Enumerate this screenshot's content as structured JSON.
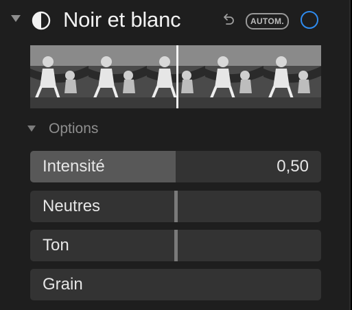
{
  "header": {
    "title": "Noir et blanc",
    "auto_label": "AUTOM.",
    "accent_color": "#2f8cf0",
    "icons": [
      "chevron-down-icon",
      "black-and-white-icon",
      "undo-icon",
      "circle-toggle-icon"
    ]
  },
  "options": {
    "label": "Options"
  },
  "sliders": [
    {
      "label": "Intensité",
      "value": "0,50",
      "level": 0.5
    },
    {
      "label": "Neutres",
      "value": "",
      "level": 0.5
    },
    {
      "label": "Ton",
      "value": "",
      "level": 0.5
    },
    {
      "label": "Grain",
      "value": "",
      "level": 0
    }
  ]
}
